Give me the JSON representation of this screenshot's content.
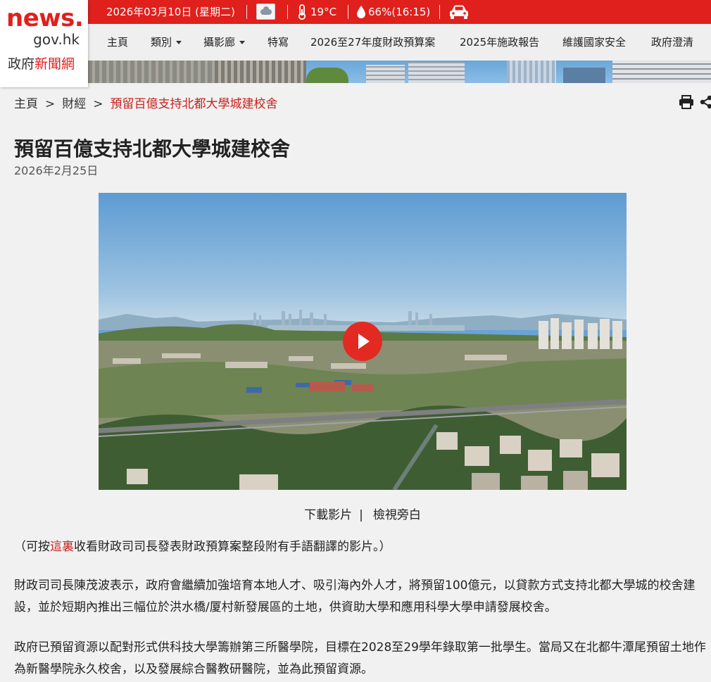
{
  "header": {
    "date": "2026年03月10日 (星期二)",
    "weather_icon": "cloudy-icon",
    "temperature": "19°C",
    "humidity": "66%(16:15)",
    "traffic_icon": "car-icon"
  },
  "logo": {
    "line1": "news.",
    "line2": "gov.hk",
    "line3_black": "政府",
    "line3_red": "新聞網"
  },
  "nav": {
    "home": "主頁",
    "category": "類別",
    "gallery": "攝影廊",
    "feature": "特寫",
    "budget": "2026至27年度財政預算案",
    "policy": "2025年施政報告",
    "security": "維護國家安全",
    "clarification": "政府澄清"
  },
  "breadcrumb": {
    "home": "主頁",
    "section": "財經",
    "current": "預留百億支持北都大學城建校舍"
  },
  "article": {
    "title": "預留百億支持北都大學城建校舍",
    "date": "2026年2月25日",
    "download_video": "下載影片",
    "audio_description": "檢視旁白",
    "note_prefix": "（可按",
    "note_link": "這裏",
    "note_suffix": "收看財政司司長發表財政預算案整段附有手語翻譯的影片。）",
    "paragraph1": "財政司司長陳茂波表示，政府會繼續加強培育本地人才、吸引海內外人才，將預留100億元，以貸款方式支持北都大學城的校舍建設，並於短期內推出三幅位於洪水橋/厦村新發展區的土地，供資助大學和應用科學大學申請發展校舍。",
    "paragraph2": "政府已預留資源以配對形式供科技大學籌辦第三所醫學院，目標在2028至29學年錄取第一批學生。當局又在北都牛潭尾預留土地作為新醫學院永久校舍，以及發展綜合醫教研醫院，並為此預留資源。"
  },
  "colors": {
    "brand_red": "#e0201c",
    "link_red": "#c7211d"
  }
}
